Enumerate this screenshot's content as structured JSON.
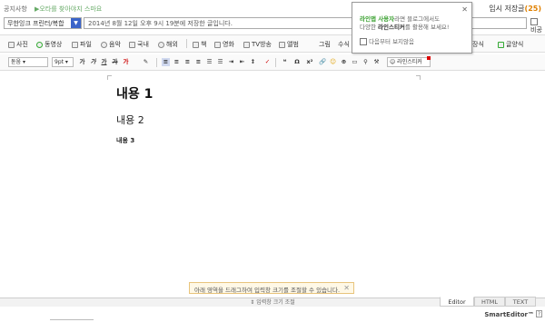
{
  "topbar": {
    "notice": "공지사항",
    "notice_link": "▶오타를 찾아야지 스마요",
    "temp_save_label": "임시 저장글",
    "temp_save_count": "(25)"
  },
  "post": {
    "category": "무한잉크 프린터/복합",
    "title": "2014년 8월 12일 오후 9시 19분에 저장한 글입니다.",
    "private_label": "비공개"
  },
  "toolbar1": [
    {
      "icon": "photo-icon",
      "label": "사진"
    },
    {
      "icon": "video-icon",
      "label": "동영상"
    },
    {
      "icon": "file-icon",
      "label": "파일"
    },
    {
      "icon": "music-icon",
      "label": "음악"
    },
    {
      "icon": "map-icon",
      "label": "국내"
    },
    {
      "icon": "global-icon",
      "label": "해외"
    },
    {
      "icon": "book-icon",
      "label": "책"
    },
    {
      "icon": "movie-icon",
      "label": "영화"
    },
    {
      "icon": "tv-icon",
      "label": "TV방송"
    },
    {
      "icon": "album-icon",
      "label": "앨범"
    },
    {
      "icon": "sticker-icon",
      "label": "그림"
    },
    {
      "icon": "formula-icon",
      "label": "수식"
    },
    {
      "icon": "template-icon",
      "label": "장식"
    },
    {
      "icon": "layout-icon",
      "label": "글양식"
    }
  ],
  "toolbar2": {
    "font": "돋움",
    "size": "9pt",
    "formats": [
      "가",
      "가",
      "가",
      "가",
      "가"
    ],
    "emoticon_label": "라인스티커"
  },
  "content": {
    "h1": "내용 1",
    "h2": "내용 2",
    "h3": "내용 3"
  },
  "popup": {
    "line1_green": "라인앱 사용자",
    "line1_rest": "라면 블로그에서도",
    "line2_pre": "다양한 ",
    "line2_bold": "라인스티커",
    "line2_post": "를 활용해 보세요!",
    "dismiss": "다음부터 보지않음"
  },
  "hint": "아래 영역을 드래그하여 입력창 크기를 조절할 수 있습니다.",
  "resize_label": "⇕ 입력창 크기 조절",
  "tabs": [
    "Editor",
    "HTML",
    "TEXT"
  ],
  "brand": "SmartEditor™",
  "help": "?"
}
